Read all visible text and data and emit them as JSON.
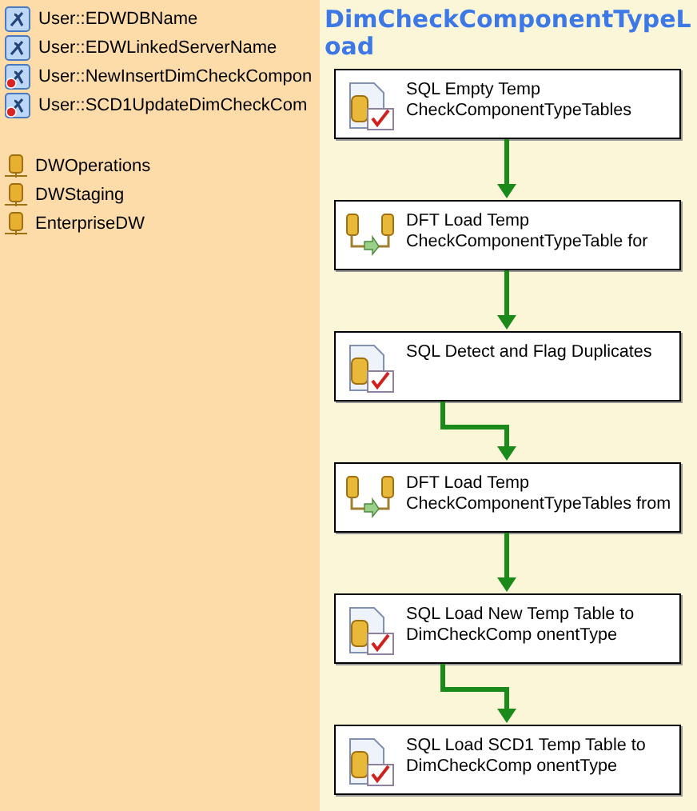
{
  "variables": [
    {
      "label": "User::EDWDBName",
      "kind": "plain"
    },
    {
      "label": "User::EDWLinkedServerName",
      "kind": "plain"
    },
    {
      "label": "User::NewInsertDimCheckCompon",
      "kind": "flagged"
    },
    {
      "label": "User::SCD1UpdateDimCheckCom",
      "kind": "flagged"
    }
  ],
  "connections": [
    {
      "label": "DWOperations"
    },
    {
      "label": "DWStaging"
    },
    {
      "label": "EnterpriseDW"
    }
  ],
  "package": {
    "title": "DimCheckComponentTypeLoad",
    "tasks": [
      {
        "kind": "sql",
        "lines": [
          "SQL Empty Temp",
          "CheckComponentTypeTables"
        ]
      },
      {
        "kind": "dataflow",
        "lines": [
          "DFT Load Temp",
          "CheckComponentTypeTable for"
        ]
      },
      {
        "kind": "sql",
        "lines": [
          "SQL Detect and Flag Duplicates"
        ]
      },
      {
        "kind": "dataflow",
        "lines": [
          "DFT Load Temp",
          "CheckComponentTypeTables from"
        ]
      },
      {
        "kind": "sql",
        "lines": [
          "SQL Load New Temp Table to",
          "DimCheckComp onentType"
        ]
      },
      {
        "kind": "sql",
        "lines": [
          "SQL Load SCD1 Temp Table to",
          "DimCheckComp onentType"
        ]
      }
    ],
    "connectors": [
      {
        "kind": "straight"
      },
      {
        "kind": "straight"
      },
      {
        "kind": "offset"
      },
      {
        "kind": "straight"
      },
      {
        "kind": "offset"
      }
    ]
  }
}
